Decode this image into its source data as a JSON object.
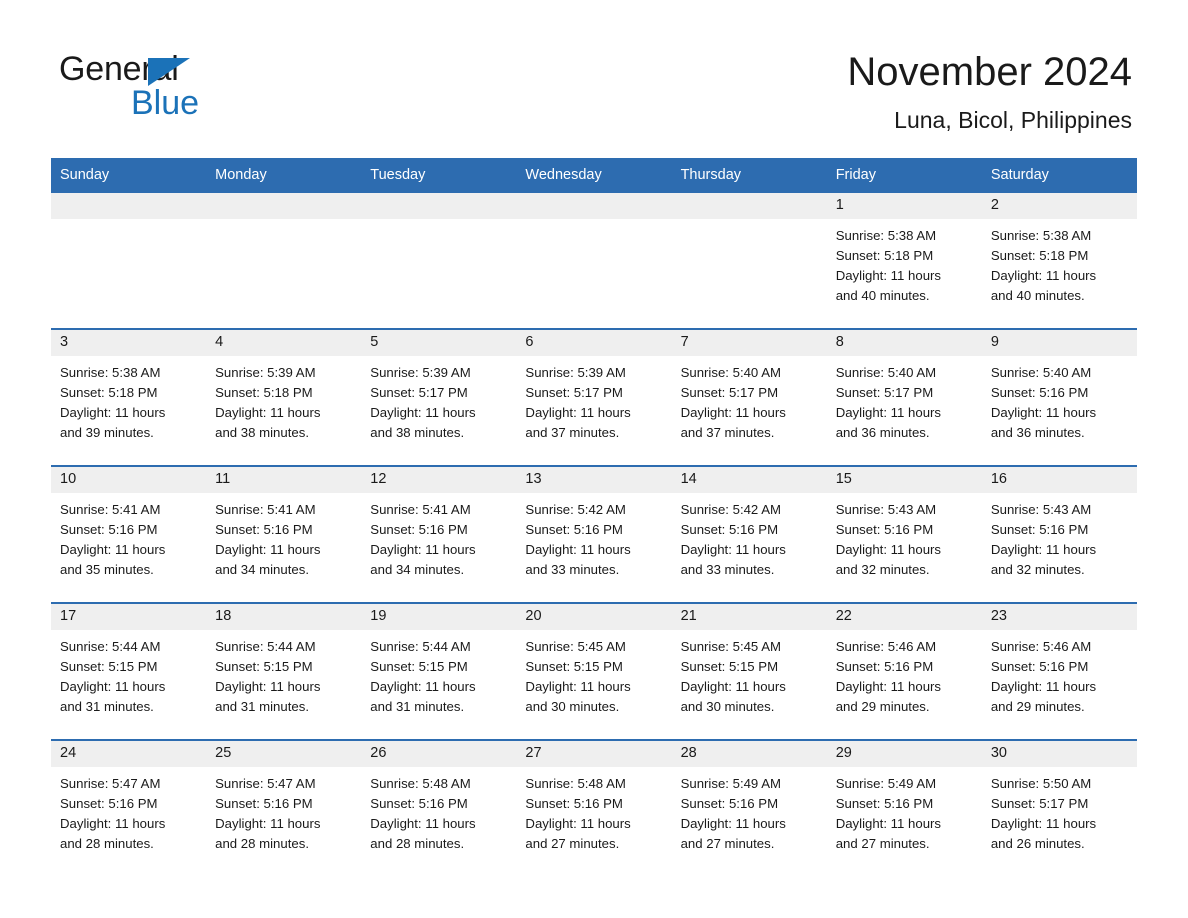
{
  "brand": {
    "name_part1": "General",
    "name_part2": "Blue",
    "logo_triangle": "blue-triangle-icon",
    "accent_color": "#1b72b8"
  },
  "header": {
    "title": "November 2024",
    "subtitle": "Luna, Bicol, Philippines",
    "header_bar_color": "#2d6cb0",
    "day_band_color": "#efefef"
  },
  "weekdays": [
    "Sunday",
    "Monday",
    "Tuesday",
    "Wednesday",
    "Thursday",
    "Friday",
    "Saturday"
  ],
  "labels": {
    "sunrise_prefix": "Sunrise:",
    "sunset_prefix": "Sunset:",
    "daylight_prefix": "Daylight:"
  },
  "weeks": [
    {
      "days": [
        {
          "empty": true
        },
        {
          "empty": true
        },
        {
          "empty": true
        },
        {
          "empty": true
        },
        {
          "empty": true
        },
        {
          "empty": false,
          "num": "1",
          "sunrise": "Sunrise: 5:38 AM",
          "sunset": "Sunset: 5:18 PM",
          "daylight1": "Daylight: 11 hours",
          "daylight2": "and 40 minutes."
        },
        {
          "empty": false,
          "num": "2",
          "sunrise": "Sunrise: 5:38 AM",
          "sunset": "Sunset: 5:18 PM",
          "daylight1": "Daylight: 11 hours",
          "daylight2": "and 40 minutes."
        }
      ]
    },
    {
      "days": [
        {
          "empty": false,
          "num": "3",
          "sunrise": "Sunrise: 5:38 AM",
          "sunset": "Sunset: 5:18 PM",
          "daylight1": "Daylight: 11 hours",
          "daylight2": "and 39 minutes."
        },
        {
          "empty": false,
          "num": "4",
          "sunrise": "Sunrise: 5:39 AM",
          "sunset": "Sunset: 5:18 PM",
          "daylight1": "Daylight: 11 hours",
          "daylight2": "and 38 minutes."
        },
        {
          "empty": false,
          "num": "5",
          "sunrise": "Sunrise: 5:39 AM",
          "sunset": "Sunset: 5:17 PM",
          "daylight1": "Daylight: 11 hours",
          "daylight2": "and 38 minutes."
        },
        {
          "empty": false,
          "num": "6",
          "sunrise": "Sunrise: 5:39 AM",
          "sunset": "Sunset: 5:17 PM",
          "daylight1": "Daylight: 11 hours",
          "daylight2": "and 37 minutes."
        },
        {
          "empty": false,
          "num": "7",
          "sunrise": "Sunrise: 5:40 AM",
          "sunset": "Sunset: 5:17 PM",
          "daylight1": "Daylight: 11 hours",
          "daylight2": "and 37 minutes."
        },
        {
          "empty": false,
          "num": "8",
          "sunrise": "Sunrise: 5:40 AM",
          "sunset": "Sunset: 5:17 PM",
          "daylight1": "Daylight: 11 hours",
          "daylight2": "and 36 minutes."
        },
        {
          "empty": false,
          "num": "9",
          "sunrise": "Sunrise: 5:40 AM",
          "sunset": "Sunset: 5:16 PM",
          "daylight1": "Daylight: 11 hours",
          "daylight2": "and 36 minutes."
        }
      ]
    },
    {
      "days": [
        {
          "empty": false,
          "num": "10",
          "sunrise": "Sunrise: 5:41 AM",
          "sunset": "Sunset: 5:16 PM",
          "daylight1": "Daylight: 11 hours",
          "daylight2": "and 35 minutes."
        },
        {
          "empty": false,
          "num": "11",
          "sunrise": "Sunrise: 5:41 AM",
          "sunset": "Sunset: 5:16 PM",
          "daylight1": "Daylight: 11 hours",
          "daylight2": "and 34 minutes."
        },
        {
          "empty": false,
          "num": "12",
          "sunrise": "Sunrise: 5:41 AM",
          "sunset": "Sunset: 5:16 PM",
          "daylight1": "Daylight: 11 hours",
          "daylight2": "and 34 minutes."
        },
        {
          "empty": false,
          "num": "13",
          "sunrise": "Sunrise: 5:42 AM",
          "sunset": "Sunset: 5:16 PM",
          "daylight1": "Daylight: 11 hours",
          "daylight2": "and 33 minutes."
        },
        {
          "empty": false,
          "num": "14",
          "sunrise": "Sunrise: 5:42 AM",
          "sunset": "Sunset: 5:16 PM",
          "daylight1": "Daylight: 11 hours",
          "daylight2": "and 33 minutes."
        },
        {
          "empty": false,
          "num": "15",
          "sunrise": "Sunrise: 5:43 AM",
          "sunset": "Sunset: 5:16 PM",
          "daylight1": "Daylight: 11 hours",
          "daylight2": "and 32 minutes."
        },
        {
          "empty": false,
          "num": "16",
          "sunrise": "Sunrise: 5:43 AM",
          "sunset": "Sunset: 5:16 PM",
          "daylight1": "Daylight: 11 hours",
          "daylight2": "and 32 minutes."
        }
      ]
    },
    {
      "days": [
        {
          "empty": false,
          "num": "17",
          "sunrise": "Sunrise: 5:44 AM",
          "sunset": "Sunset: 5:15 PM",
          "daylight1": "Daylight: 11 hours",
          "daylight2": "and 31 minutes."
        },
        {
          "empty": false,
          "num": "18",
          "sunrise": "Sunrise: 5:44 AM",
          "sunset": "Sunset: 5:15 PM",
          "daylight1": "Daylight: 11 hours",
          "daylight2": "and 31 minutes."
        },
        {
          "empty": false,
          "num": "19",
          "sunrise": "Sunrise: 5:44 AM",
          "sunset": "Sunset: 5:15 PM",
          "daylight1": "Daylight: 11 hours",
          "daylight2": "and 31 minutes."
        },
        {
          "empty": false,
          "num": "20",
          "sunrise": "Sunrise: 5:45 AM",
          "sunset": "Sunset: 5:15 PM",
          "daylight1": "Daylight: 11 hours",
          "daylight2": "and 30 minutes."
        },
        {
          "empty": false,
          "num": "21",
          "sunrise": "Sunrise: 5:45 AM",
          "sunset": "Sunset: 5:15 PM",
          "daylight1": "Daylight: 11 hours",
          "daylight2": "and 30 minutes."
        },
        {
          "empty": false,
          "num": "22",
          "sunrise": "Sunrise: 5:46 AM",
          "sunset": "Sunset: 5:16 PM",
          "daylight1": "Daylight: 11 hours",
          "daylight2": "and 29 minutes."
        },
        {
          "empty": false,
          "num": "23",
          "sunrise": "Sunrise: 5:46 AM",
          "sunset": "Sunset: 5:16 PM",
          "daylight1": "Daylight: 11 hours",
          "daylight2": "and 29 minutes."
        }
      ]
    },
    {
      "days": [
        {
          "empty": false,
          "num": "24",
          "sunrise": "Sunrise: 5:47 AM",
          "sunset": "Sunset: 5:16 PM",
          "daylight1": "Daylight: 11 hours",
          "daylight2": "and 28 minutes."
        },
        {
          "empty": false,
          "num": "25",
          "sunrise": "Sunrise: 5:47 AM",
          "sunset": "Sunset: 5:16 PM",
          "daylight1": "Daylight: 11 hours",
          "daylight2": "and 28 minutes."
        },
        {
          "empty": false,
          "num": "26",
          "sunrise": "Sunrise: 5:48 AM",
          "sunset": "Sunset: 5:16 PM",
          "daylight1": "Daylight: 11 hours",
          "daylight2": "and 28 minutes."
        },
        {
          "empty": false,
          "num": "27",
          "sunrise": "Sunrise: 5:48 AM",
          "sunset": "Sunset: 5:16 PM",
          "daylight1": "Daylight: 11 hours",
          "daylight2": "and 27 minutes."
        },
        {
          "empty": false,
          "num": "28",
          "sunrise": "Sunrise: 5:49 AM",
          "sunset": "Sunset: 5:16 PM",
          "daylight1": "Daylight: 11 hours",
          "daylight2": "and 27 minutes."
        },
        {
          "empty": false,
          "num": "29",
          "sunrise": "Sunrise: 5:49 AM",
          "sunset": "Sunset: 5:16 PM",
          "daylight1": "Daylight: 11 hours",
          "daylight2": "and 27 minutes."
        },
        {
          "empty": false,
          "num": "30",
          "sunrise": "Sunrise: 5:50 AM",
          "sunset": "Sunset: 5:17 PM",
          "daylight1": "Daylight: 11 hours",
          "daylight2": "and 26 minutes."
        }
      ]
    }
  ]
}
